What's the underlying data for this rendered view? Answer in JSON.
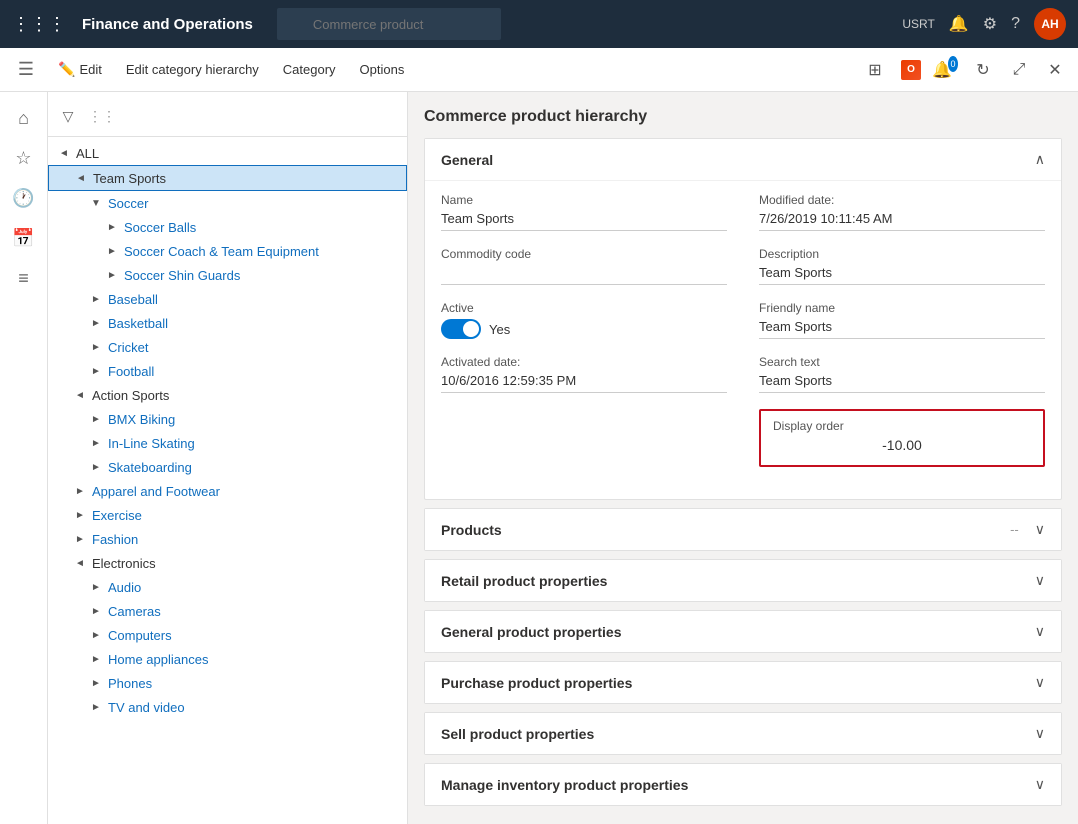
{
  "app": {
    "title": "Finance and Operations",
    "user": "USRT",
    "avatar_initials": "AH",
    "search_placeholder": "Commerce product"
  },
  "command_bar": {
    "edit_label": "Edit",
    "edit_hierarchy_label": "Edit category hierarchy",
    "category_label": "Category",
    "options_label": "Options"
  },
  "tree": {
    "root_label": "ALL",
    "items": [
      {
        "id": "team-sports",
        "label": "Team Sports",
        "level": 1,
        "expanded": true,
        "selected": true,
        "expand_icon": "◄"
      },
      {
        "id": "soccer",
        "label": "Soccer",
        "level": 2,
        "expanded": true,
        "expand_icon": "▼"
      },
      {
        "id": "soccer-balls",
        "label": "Soccer Balls",
        "level": 3,
        "expand_icon": "►"
      },
      {
        "id": "soccer-coach",
        "label": "Soccer Coach & Team Equipment",
        "level": 3,
        "expand_icon": "►"
      },
      {
        "id": "soccer-shin",
        "label": "Soccer Shin Guards",
        "level": 3,
        "expand_icon": "►"
      },
      {
        "id": "baseball",
        "label": "Baseball",
        "level": 2,
        "expand_icon": "►"
      },
      {
        "id": "basketball",
        "label": "Basketball",
        "level": 2,
        "expand_icon": "►"
      },
      {
        "id": "cricket",
        "label": "Cricket",
        "level": 2,
        "expand_icon": "►"
      },
      {
        "id": "football",
        "label": "Football",
        "level": 2,
        "expand_icon": "►"
      },
      {
        "id": "action-sports",
        "label": "Action Sports",
        "level": 1,
        "expanded": true,
        "expand_icon": "◄"
      },
      {
        "id": "bmx",
        "label": "BMX Biking",
        "level": 2,
        "expand_icon": "►"
      },
      {
        "id": "inline",
        "label": "In-Line Skating",
        "level": 2,
        "expand_icon": "►"
      },
      {
        "id": "skate",
        "label": "Skateboarding",
        "level": 2,
        "expand_icon": "►"
      },
      {
        "id": "apparel",
        "label": "Apparel and Footwear",
        "level": 1,
        "expand_icon": "►"
      },
      {
        "id": "exercise",
        "label": "Exercise",
        "level": 1,
        "expand_icon": "►"
      },
      {
        "id": "fashion",
        "label": "Fashion",
        "level": 1,
        "expand_icon": "►"
      },
      {
        "id": "electronics",
        "label": "Electronics",
        "level": 1,
        "expanded": true,
        "expand_icon": "◄"
      },
      {
        "id": "audio",
        "label": "Audio",
        "level": 2,
        "expand_icon": "►"
      },
      {
        "id": "cameras",
        "label": "Cameras",
        "level": 2,
        "expand_icon": "►"
      },
      {
        "id": "computers",
        "label": "Computers",
        "level": 2,
        "expand_icon": "►"
      },
      {
        "id": "home-appliances",
        "label": "Home appliances",
        "level": 2,
        "expand_icon": "►"
      },
      {
        "id": "phones",
        "label": "Phones",
        "level": 2,
        "expand_icon": "►"
      },
      {
        "id": "tv-video",
        "label": "TV and video",
        "level": 2,
        "expand_icon": "►"
      }
    ]
  },
  "detail": {
    "header": "Commerce product hierarchy",
    "sections": {
      "general": {
        "title": "General",
        "expanded": true,
        "fields": {
          "name_label": "Name",
          "name_value": "Team Sports",
          "modified_date_label": "Modified date:",
          "modified_date_value": "7/26/2019 10:11:45 AM",
          "commodity_code_label": "Commodity code",
          "commodity_code_value": "",
          "description_label": "Description",
          "description_value": "Team Sports",
          "active_label": "Active",
          "active_value": "Yes",
          "friendly_name_label": "Friendly name",
          "friendly_name_value": "Team Sports",
          "activated_date_label": "Activated date:",
          "activated_date_value": "10/6/2016 12:59:35 PM",
          "search_text_label": "Search text",
          "search_text_value": "Team Sports",
          "display_order_label": "Display order",
          "display_order_value": "-10.00"
        }
      },
      "products": {
        "title": "Products",
        "expanded": false,
        "dash": "--"
      },
      "retail_product_properties": {
        "title": "Retail product properties",
        "expanded": false
      },
      "general_product_properties": {
        "title": "General product properties",
        "expanded": false
      },
      "purchase_product_properties": {
        "title": "Purchase product properties",
        "expanded": false
      },
      "sell_product_properties": {
        "title": "Sell product properties",
        "expanded": false
      },
      "manage_inventory": {
        "title": "Manage inventory product properties",
        "expanded": false
      }
    }
  }
}
